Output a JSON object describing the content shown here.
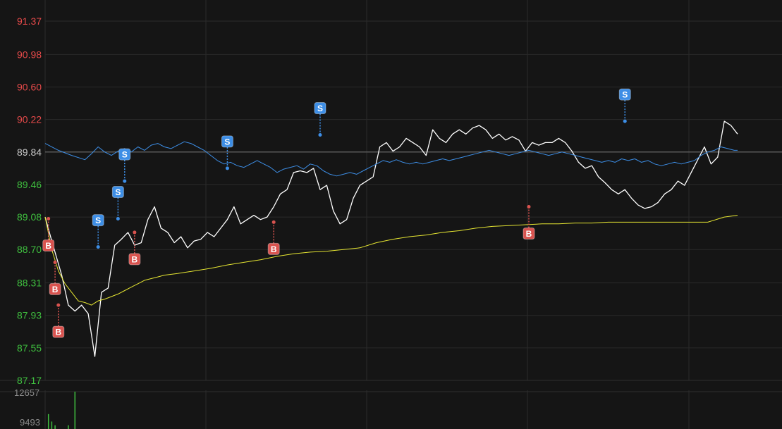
{
  "chart_data": {
    "type": "line",
    "price_axis": {
      "ylim": [
        87.17,
        91.37
      ],
      "ticks": [
        "91.37",
        "90.98",
        "90.60",
        "90.22",
        "89.84",
        "89.46",
        "89.08",
        "88.70",
        "88.31",
        "87.93",
        "87.55",
        "87.17"
      ],
      "reference_tick": "89.84",
      "above_color": "#e64a4a",
      "below_color": "#3fbf3f",
      "reference_color": "#c8c8c8"
    },
    "volume_axis": {
      "ticks": [
        "12657",
        "9493"
      ]
    },
    "x_count": 140,
    "series": [
      {
        "key": "price",
        "color": "#ffffff",
        "points": [
          [
            0,
            89.08
          ],
          [
            2,
            88.8
          ],
          [
            5,
            88.4
          ],
          [
            7,
            88.05
          ],
          [
            9,
            87.98
          ],
          [
            11,
            88.05
          ],
          [
            13,
            87.95
          ],
          [
            15,
            87.45
          ],
          [
            17,
            88.2
          ],
          [
            19,
            88.25
          ],
          [
            21,
            88.75
          ],
          [
            23,
            88.82
          ],
          [
            25,
            88.9
          ],
          [
            27,
            88.75
          ],
          [
            29,
            88.78
          ],
          [
            31,
            89.05
          ],
          [
            33,
            89.2
          ],
          [
            35,
            88.95
          ],
          [
            37,
            88.9
          ],
          [
            39,
            88.78
          ],
          [
            41,
            88.85
          ],
          [
            43,
            88.72
          ],
          [
            45,
            88.8
          ],
          [
            47,
            88.82
          ],
          [
            49,
            88.9
          ],
          [
            51,
            88.85
          ],
          [
            53,
            88.95
          ],
          [
            55,
            89.05
          ],
          [
            57,
            89.2
          ],
          [
            59,
            89.0
          ],
          [
            61,
            89.05
          ],
          [
            63,
            89.1
          ],
          [
            65,
            89.05
          ],
          [
            67,
            89.08
          ],
          [
            69,
            89.2
          ],
          [
            71,
            89.35
          ],
          [
            73,
            89.4
          ],
          [
            75,
            89.6
          ],
          [
            77,
            89.62
          ],
          [
            79,
            89.6
          ],
          [
            81,
            89.65
          ],
          [
            83,
            89.4
          ],
          [
            85,
            89.45
          ],
          [
            87,
            89.15
          ],
          [
            89,
            89.0
          ],
          [
            91,
            89.05
          ],
          [
            93,
            89.3
          ],
          [
            95,
            89.45
          ],
          [
            97,
            89.5
          ],
          [
            99,
            89.55
          ],
          [
            101,
            89.9
          ],
          [
            103,
            89.95
          ],
          [
            105,
            89.85
          ],
          [
            107,
            89.9
          ],
          [
            109,
            90.0
          ],
          [
            111,
            89.95
          ],
          [
            113,
            89.9
          ],
          [
            115,
            89.8
          ],
          [
            117,
            90.1
          ],
          [
            119,
            90.0
          ],
          [
            121,
            89.95
          ],
          [
            123,
            90.05
          ],
          [
            125,
            90.1
          ],
          [
            127,
            90.05
          ],
          [
            129,
            90.12
          ],
          [
            131,
            90.15
          ],
          [
            133,
            90.1
          ],
          [
            135,
            90.0
          ],
          [
            137,
            90.05
          ],
          [
            139,
            89.98
          ],
          [
            141,
            90.02
          ],
          [
            143,
            89.98
          ],
          [
            145,
            89.85
          ],
          [
            147,
            89.95
          ],
          [
            149,
            89.92
          ],
          [
            151,
            89.95
          ],
          [
            153,
            89.95
          ],
          [
            155,
            90.0
          ],
          [
            157,
            89.95
          ],
          [
            159,
            89.85
          ],
          [
            161,
            89.72
          ],
          [
            163,
            89.65
          ],
          [
            165,
            89.68
          ],
          [
            167,
            89.55
          ],
          [
            169,
            89.48
          ],
          [
            171,
            89.4
          ],
          [
            173,
            89.35
          ],
          [
            175,
            89.4
          ],
          [
            177,
            89.3
          ],
          [
            179,
            89.22
          ],
          [
            181,
            89.18
          ],
          [
            183,
            89.2
          ],
          [
            185,
            89.25
          ],
          [
            187,
            89.35
          ],
          [
            189,
            89.4
          ],
          [
            191,
            89.5
          ],
          [
            193,
            89.45
          ],
          [
            195,
            89.6
          ],
          [
            197,
            89.75
          ],
          [
            199,
            89.9
          ],
          [
            201,
            89.7
          ],
          [
            203,
            89.78
          ],
          [
            205,
            90.2
          ],
          [
            207,
            90.15
          ],
          [
            209,
            90.05
          ]
        ],
        "x_scale": 209
      },
      {
        "key": "avg_blue",
        "color": "#3d8ee6",
        "points": [
          [
            0,
            89.94
          ],
          [
            4,
            89.86
          ],
          [
            8,
            89.8
          ],
          [
            12,
            89.75
          ],
          [
            14,
            89.82
          ],
          [
            16,
            89.9
          ],
          [
            18,
            89.84
          ],
          [
            20,
            89.8
          ],
          [
            22,
            89.85
          ],
          [
            24,
            89.88
          ],
          [
            26,
            89.84
          ],
          [
            28,
            89.9
          ],
          [
            30,
            89.86
          ],
          [
            32,
            89.92
          ],
          [
            34,
            89.94
          ],
          [
            36,
            89.9
          ],
          [
            38,
            89.88
          ],
          [
            40,
            89.92
          ],
          [
            42,
            89.96
          ],
          [
            44,
            89.94
          ],
          [
            46,
            89.9
          ],
          [
            48,
            89.86
          ],
          [
            50,
            89.8
          ],
          [
            52,
            89.74
          ],
          [
            54,
            89.7
          ],
          [
            56,
            89.72
          ],
          [
            58,
            89.68
          ],
          [
            60,
            89.66
          ],
          [
            62,
            89.7
          ],
          [
            64,
            89.74
          ],
          [
            66,
            89.7
          ],
          [
            68,
            89.66
          ],
          [
            70,
            89.6
          ],
          [
            72,
            89.64
          ],
          [
            74,
            89.66
          ],
          [
            76,
            89.68
          ],
          [
            78,
            89.64
          ],
          [
            80,
            89.7
          ],
          [
            82,
            89.68
          ],
          [
            84,
            89.62
          ],
          [
            86,
            89.58
          ],
          [
            88,
            89.56
          ],
          [
            90,
            89.58
          ],
          [
            92,
            89.6
          ],
          [
            94,
            89.58
          ],
          [
            96,
            89.62
          ],
          [
            98,
            89.66
          ],
          [
            100,
            89.7
          ],
          [
            102,
            89.74
          ],
          [
            104,
            89.72
          ],
          [
            106,
            89.75
          ],
          [
            108,
            89.72
          ],
          [
            110,
            89.7
          ],
          [
            112,
            89.72
          ],
          [
            114,
            89.7
          ],
          [
            116,
            89.72
          ],
          [
            118,
            89.74
          ],
          [
            120,
            89.76
          ],
          [
            122,
            89.74
          ],
          [
            124,
            89.76
          ],
          [
            126,
            89.78
          ],
          [
            128,
            89.8
          ],
          [
            130,
            89.82
          ],
          [
            132,
            89.84
          ],
          [
            134,
            89.86
          ],
          [
            136,
            89.84
          ],
          [
            138,
            89.82
          ],
          [
            140,
            89.8
          ],
          [
            142,
            89.82
          ],
          [
            144,
            89.84
          ],
          [
            146,
            89.86
          ],
          [
            148,
            89.84
          ],
          [
            150,
            89.82
          ],
          [
            152,
            89.8
          ],
          [
            154,
            89.82
          ],
          [
            156,
            89.84
          ],
          [
            158,
            89.82
          ],
          [
            160,
            89.8
          ],
          [
            162,
            89.78
          ],
          [
            164,
            89.76
          ],
          [
            166,
            89.74
          ],
          [
            168,
            89.72
          ],
          [
            170,
            89.74
          ],
          [
            172,
            89.72
          ],
          [
            174,
            89.76
          ],
          [
            176,
            89.74
          ],
          [
            178,
            89.76
          ],
          [
            180,
            89.72
          ],
          [
            182,
            89.74
          ],
          [
            184,
            89.7
          ],
          [
            186,
            89.68
          ],
          [
            188,
            89.7
          ],
          [
            190,
            89.72
          ],
          [
            192,
            89.7
          ],
          [
            194,
            89.72
          ],
          [
            196,
            89.74
          ],
          [
            198,
            89.8
          ],
          [
            200,
            89.84
          ],
          [
            202,
            89.86
          ],
          [
            204,
            89.9
          ],
          [
            206,
            89.88
          ],
          [
            208,
            89.86
          ],
          [
            209,
            89.86
          ]
        ],
        "x_scale": 209
      },
      {
        "key": "avg_yellow",
        "color": "#e6e632",
        "points": [
          [
            0,
            89.08
          ],
          [
            2,
            88.7
          ],
          [
            4,
            88.45
          ],
          [
            6,
            88.3
          ],
          [
            8,
            88.2
          ],
          [
            10,
            88.1
          ],
          [
            12,
            88.08
          ],
          [
            14,
            88.05
          ],
          [
            16,
            88.1
          ],
          [
            18,
            88.12
          ],
          [
            20,
            88.15
          ],
          [
            22,
            88.18
          ],
          [
            24,
            88.22
          ],
          [
            26,
            88.26
          ],
          [
            28,
            88.3
          ],
          [
            30,
            88.34
          ],
          [
            32,
            88.36
          ],
          [
            34,
            88.38
          ],
          [
            36,
            88.4
          ],
          [
            40,
            88.42
          ],
          [
            45,
            88.45
          ],
          [
            50,
            88.48
          ],
          [
            55,
            88.52
          ],
          [
            60,
            88.55
          ],
          [
            65,
            88.58
          ],
          [
            70,
            88.62
          ],
          [
            75,
            88.65
          ],
          [
            80,
            88.67
          ],
          [
            85,
            88.68
          ],
          [
            90,
            88.7
          ],
          [
            95,
            88.72
          ],
          [
            100,
            88.78
          ],
          [
            105,
            88.82
          ],
          [
            110,
            88.85
          ],
          [
            115,
            88.87
          ],
          [
            120,
            88.9
          ],
          [
            125,
            88.92
          ],
          [
            130,
            88.95
          ],
          [
            135,
            88.97
          ],
          [
            140,
            88.98
          ],
          [
            145,
            88.99
          ],
          [
            150,
            89.0
          ],
          [
            155,
            89.0
          ],
          [
            160,
            89.01
          ],
          [
            165,
            89.01
          ],
          [
            170,
            89.02
          ],
          [
            175,
            89.02
          ],
          [
            180,
            89.02
          ],
          [
            185,
            89.02
          ],
          [
            190,
            89.02
          ],
          [
            195,
            89.02
          ],
          [
            200,
            89.02
          ],
          [
            205,
            89.08
          ],
          [
            209,
            89.1
          ]
        ],
        "x_scale": 209
      }
    ],
    "signals": [
      {
        "label": "B",
        "x": 1,
        "y": 89.06,
        "dir": "down",
        "color": "#d9534f"
      },
      {
        "label": "B",
        "x": 3,
        "y": 88.55,
        "dir": "down",
        "color": "#d9534f"
      },
      {
        "label": "B",
        "x": 4,
        "y": 88.05,
        "dir": "down",
        "color": "#d9534f"
      },
      {
        "label": "S",
        "x": 16,
        "y": 88.73,
        "dir": "up",
        "color": "#3d8ee6"
      },
      {
        "label": "S",
        "x": 22,
        "y": 89.06,
        "dir": "up",
        "color": "#3d8ee6"
      },
      {
        "label": "S",
        "x": 24,
        "y": 89.5,
        "dir": "up",
        "color": "#3d8ee6"
      },
      {
        "label": "B",
        "x": 27,
        "y": 88.9,
        "dir": "down",
        "color": "#d9534f"
      },
      {
        "label": "S",
        "x": 55,
        "y": 89.65,
        "dir": "up",
        "color": "#3d8ee6"
      },
      {
        "label": "B",
        "x": 69,
        "y": 89.02,
        "dir": "down",
        "color": "#d9534f"
      },
      {
        "label": "S",
        "x": 83,
        "y": 90.04,
        "dir": "up",
        "color": "#3d8ee6"
      },
      {
        "label": "B",
        "x": 146,
        "y": 89.2,
        "dir": "down",
        "color": "#d9534f"
      },
      {
        "label": "S",
        "x": 175,
        "y": 90.2,
        "dir": "up",
        "color": "#3d8ee6"
      }
    ],
    "signal_x_scale": 209,
    "volume_bars": [
      {
        "x": 1,
        "v": 0.4,
        "color": "#3fbf3f"
      },
      {
        "x": 2,
        "v": 0.2,
        "color": "#3fbf3f"
      },
      {
        "x": 3,
        "v": 0.1,
        "color": "#3fbf3f"
      },
      {
        "x": 7,
        "v": 0.1,
        "color": "#3fbf3f"
      },
      {
        "x": 9,
        "v": 1.0,
        "color": "#3fbf3f"
      }
    ],
    "grid": true
  }
}
